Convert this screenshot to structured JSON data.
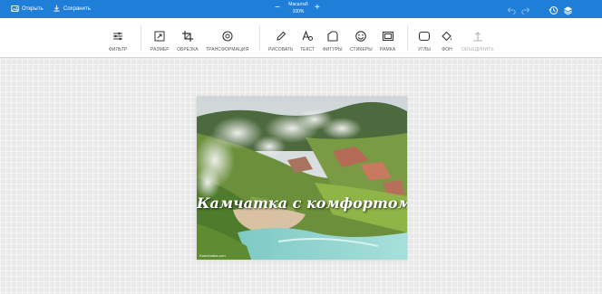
{
  "topbar": {
    "open_label": "Открыть",
    "save_label": "Сохранить",
    "zoom_label": "Масштаб",
    "zoom_value": "100%",
    "zoom_minus": "−",
    "zoom_plus": "+",
    "accent": "#1f7fd8"
  },
  "toolbar": {
    "tools": {
      "filter": "ФИЛЬТР",
      "resize": "РАЗМЕР",
      "crop": "ОБРЕЗКА",
      "transform": "ТРАНСФОРМАЦИЯ",
      "draw": "РИСОВАТЬ",
      "text": "ТЕКСТ",
      "shapes": "ФИГУРЫ",
      "stickers": "СТИКЕРЫ",
      "frame": "РАМКА",
      "corners": "УГЛЫ",
      "background": "ФОН",
      "merge": "ОБЪЕДИНИТЬ"
    }
  },
  "canvas": {
    "photo_caption": "Камчатка с комфортом!",
    "watermark": "Kamchatka.com"
  }
}
